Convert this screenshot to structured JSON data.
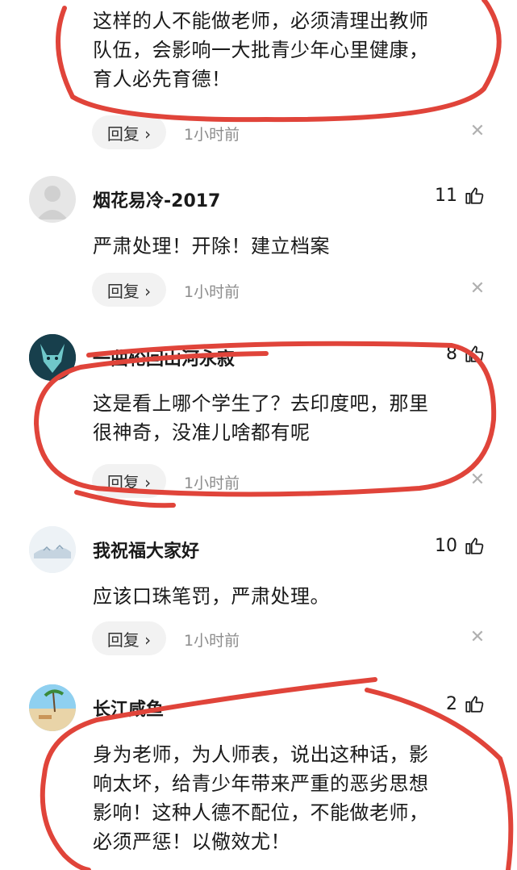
{
  "comments": [
    {
      "name": "",
      "text_lines": [
        "这样的人不能做老师，必须清理出教师",
        "队伍，会影响一大批青少年心里健康，",
        "育人必先育德！"
      ],
      "reply_label": "回复 ›",
      "time": "1小时前",
      "close_glyph": "✕"
    },
    {
      "name": "烟花易冷-2017",
      "likes": "11",
      "text_lines": [
        "严肃处理！开除！建立档案"
      ],
      "reply_label": "回复 ›",
      "time": "1小时前",
      "close_glyph": "✕"
    },
    {
      "name": "一曲轮回山河永寂",
      "likes": "8",
      "text_lines": [
        "这是看上哪个学生了？去印度吧，那里",
        "很神奇，没准儿啥都有呢"
      ],
      "reply_label": "回复 ›",
      "time": "1小时前",
      "close_glyph": "✕"
    },
    {
      "name": "我祝福大家好",
      "likes": "10",
      "text_lines": [
        "应该口珠笔罚，严肃处理。"
      ],
      "reply_label": "回复 ›",
      "time": "1小时前",
      "close_glyph": "✕"
    },
    {
      "name": "长江咸鱼",
      "likes": "2",
      "text_lines": [
        "身为老师，为人师表，说出这种话，影",
        "响太坏，给青少年带来严重的恶劣思想",
        "影响！这种人德不配位，不能做老师，",
        "必须严惩！以儆效尤！"
      ]
    }
  ],
  "colors": {
    "annotation_red": "#e0443a",
    "reply_bg": "#f2f2f2"
  },
  "icons": {
    "like": "thumbs-up-icon",
    "close": "close-icon"
  }
}
